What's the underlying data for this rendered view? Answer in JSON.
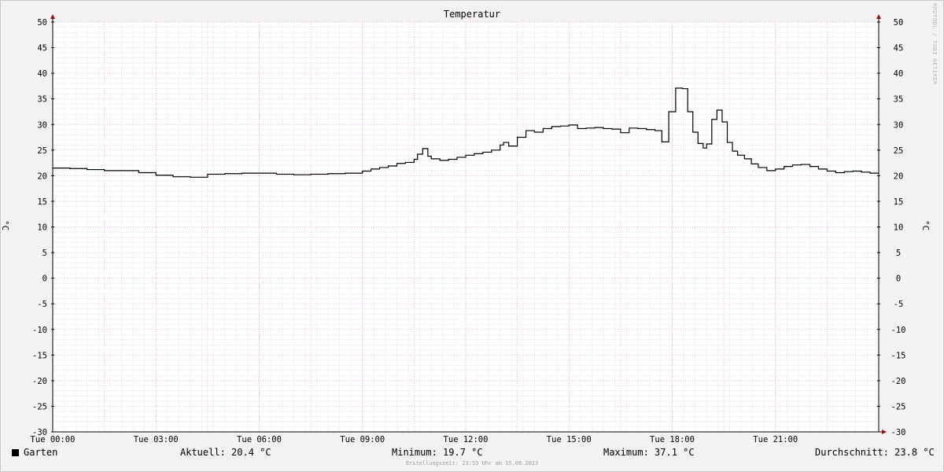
{
  "chart_data": {
    "type": "line",
    "title": "Temperatur",
    "ylabel": "°C",
    "ylim": [
      -30,
      50
    ],
    "ytick_values": [
      50,
      45,
      40,
      35,
      30,
      25,
      20,
      15,
      10,
      5,
      0,
      -5,
      -10,
      -15,
      -20,
      -25,
      -30
    ],
    "ytick_labels": [
      "50",
      "45",
      "40",
      "35",
      "30",
      "25",
      "20",
      "15",
      "10",
      "5",
      "0",
      "-5",
      "-10",
      "-15",
      "-20",
      "-25",
      "-30"
    ],
    "xlim": [
      0,
      24
    ],
    "xtick_values": [
      0,
      3,
      6,
      9,
      12,
      15,
      18,
      21
    ],
    "xtick_labels": [
      "Tue 00:00",
      "Tue 03:00",
      "Tue 06:00",
      "Tue 09:00",
      "Tue 12:00",
      "Tue 15:00",
      "Tue 18:00",
      "Tue 21:00"
    ],
    "grid": true,
    "series": [
      {
        "name": "Garten",
        "color": "#000000",
        "x": [
          0,
          0.5,
          1,
          1.5,
          2,
          2.5,
          3,
          3.5,
          4,
          4.5,
          5,
          5.5,
          6,
          6.5,
          7,
          7.5,
          8,
          8.5,
          9,
          9.25,
          9.5,
          9.75,
          10,
          10.25,
          10.5,
          10.6,
          10.75,
          10.9,
          11,
          11.25,
          11.5,
          11.75,
          12,
          12.25,
          12.5,
          12.75,
          13,
          13.1,
          13.25,
          13.5,
          13.75,
          14,
          14.25,
          14.5,
          14.75,
          15,
          15.25,
          15.5,
          15.75,
          16,
          16.25,
          16.5,
          16.75,
          17,
          17.25,
          17.5,
          17.7,
          17.9,
          18.1,
          18.3,
          18.45,
          18.6,
          18.75,
          18.9,
          19.0,
          19.15,
          19.3,
          19.45,
          19.6,
          19.75,
          19.9,
          20.1,
          20.3,
          20.5,
          20.75,
          21,
          21.25,
          21.5,
          21.75,
          22,
          22.25,
          22.5,
          22.75,
          23,
          23.25,
          23.5,
          23.75,
          24
        ],
        "y": [
          21.5,
          21.4,
          21.2,
          21.0,
          21.0,
          20.6,
          20.1,
          19.8,
          19.7,
          20.3,
          20.4,
          20.5,
          20.5,
          20.3,
          20.2,
          20.3,
          20.4,
          20.5,
          20.9,
          21.3,
          21.6,
          21.9,
          22.4,
          22.6,
          23.2,
          24.2,
          25.3,
          23.8,
          23.3,
          23.0,
          23.2,
          23.6,
          24.0,
          24.3,
          24.6,
          25.0,
          26.0,
          26.5,
          25.8,
          27.5,
          28.8,
          28.5,
          29.2,
          29.6,
          29.7,
          29.9,
          29.2,
          29.3,
          29.4,
          29.2,
          29.1,
          28.4,
          29.3,
          29.2,
          29.0,
          28.8,
          26.6,
          32.5,
          37.1,
          37.0,
          32.5,
          28.5,
          26.3,
          25.4,
          26.2,
          31.0,
          32.8,
          30.5,
          26.5,
          24.8,
          24.0,
          23.3,
          22.3,
          21.6,
          21.0,
          21.3,
          21.8,
          22.1,
          22.2,
          21.8,
          21.3,
          20.9,
          20.6,
          20.8,
          20.9,
          20.7,
          20.5,
          20.4
        ]
      }
    ]
  },
  "legend": {
    "series_name": "Garten",
    "current": "Aktuell: 20.4 °C",
    "minimum": "Minimum: 19.7 °C",
    "maximum": "Maximum: 37.1 °C",
    "average": "Durchschnitt: 23.8 °C"
  },
  "footer": "Erstellungszeit: 23:55 Uhr am 15.08.2023",
  "watermark": "RRDTOOL / TOBI OETIKER",
  "colors": {
    "background": "#f3f3f3",
    "plot_background": "#ffffff",
    "major_grid": "#e6a0a0",
    "minor_grid": "#d8d8d8",
    "line": "#000000",
    "axis_arrow": "#a01010"
  }
}
